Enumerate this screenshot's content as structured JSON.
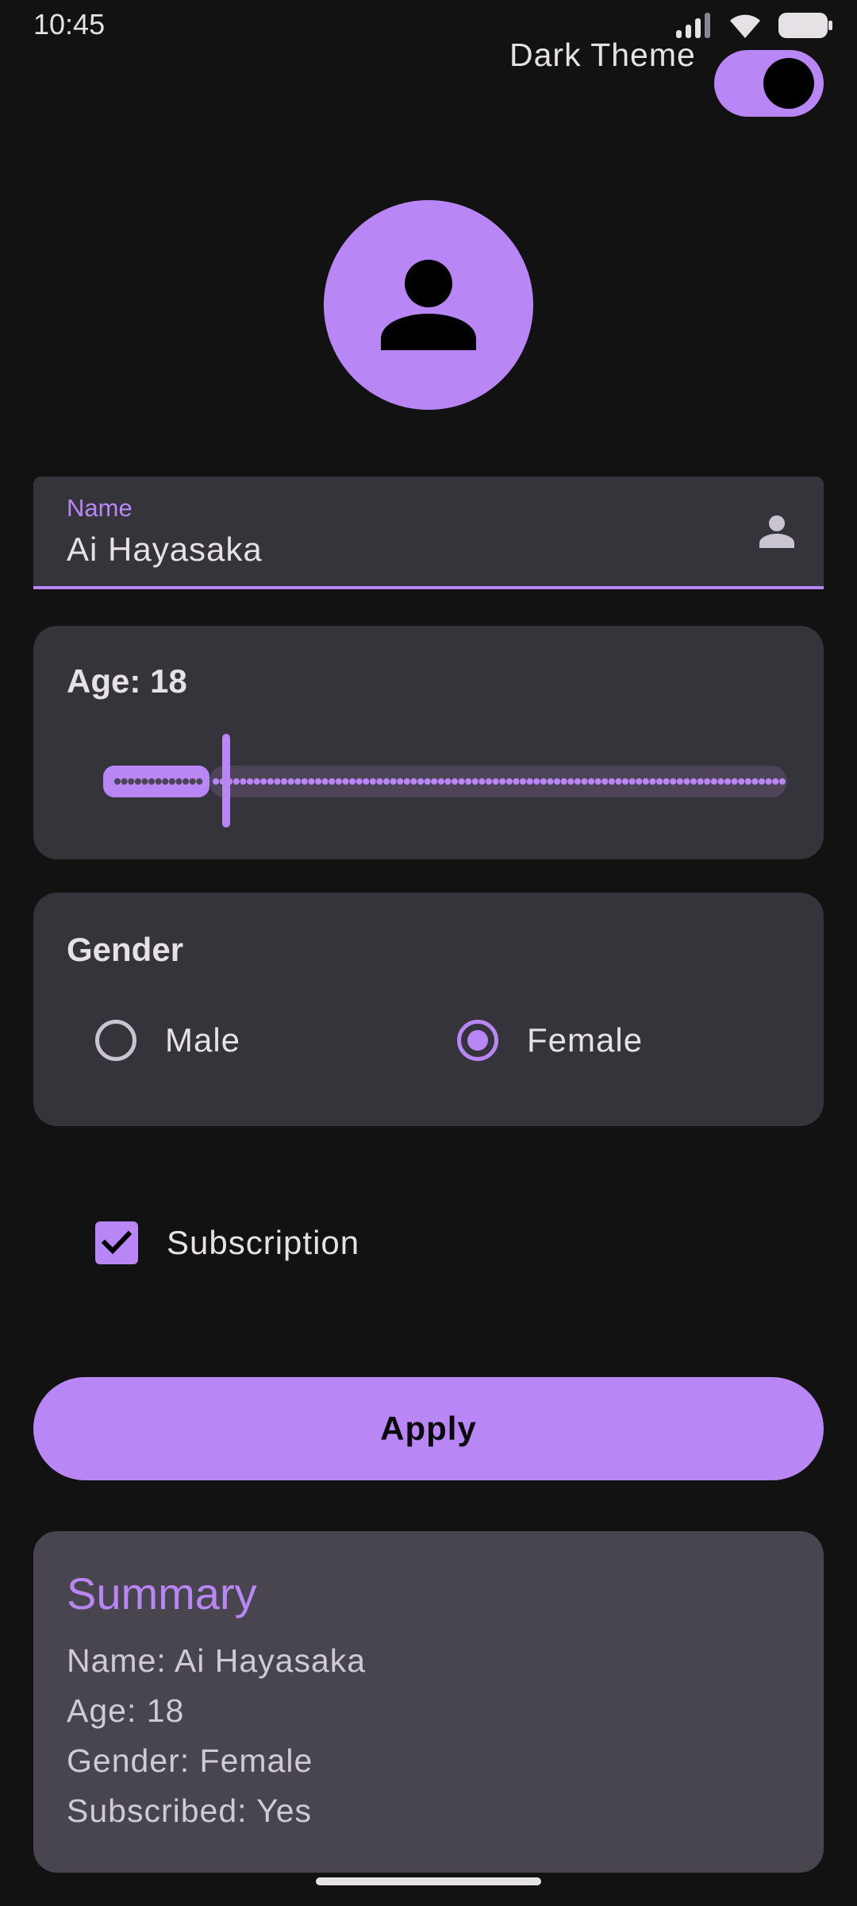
{
  "status_bar": {
    "time": "10:45"
  },
  "theme_toggle": {
    "label": "Dark Theme",
    "on": true
  },
  "name_field": {
    "label": "Name",
    "value": "Ai Hayasaka"
  },
  "age": {
    "label": "Age: 18",
    "value": 18,
    "fraction": 0.155
  },
  "gender": {
    "title": "Gender",
    "options": [
      {
        "label": "Male",
        "selected": false
      },
      {
        "label": "Female",
        "selected": true
      }
    ]
  },
  "subscription": {
    "label": "Subscription",
    "checked": true
  },
  "apply_button": {
    "label": "Apply"
  },
  "summary": {
    "title": "Summary",
    "lines": [
      "Name: Ai Hayasaka",
      "Age: 18",
      "Gender: Female",
      "Subscribed: Yes"
    ]
  },
  "colors": {
    "accent": "#b986f6",
    "background": "#121212",
    "surface": "#36343b",
    "summary_surface": "#49454f"
  },
  "icons": [
    "signal-icon",
    "wifi-icon",
    "battery-icon",
    "person-icon",
    "check-icon"
  ]
}
